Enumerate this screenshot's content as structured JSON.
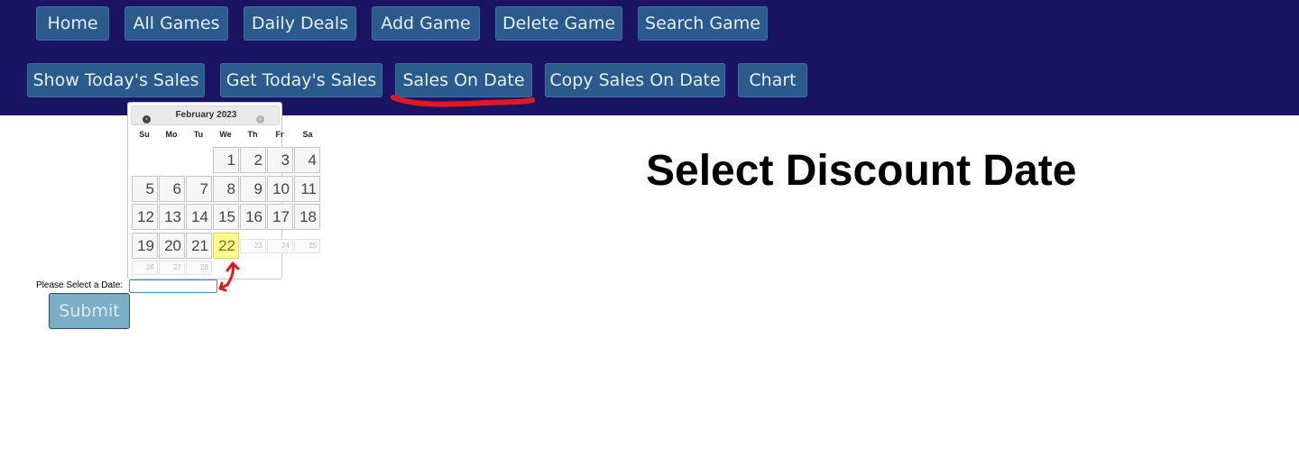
{
  "nav": {
    "row1": [
      "Home",
      "All Games",
      "Daily Deals",
      "Add Game",
      "Delete Game",
      "Search Game"
    ],
    "row2": [
      "Show Today's Sales",
      "Get Today's Sales",
      "Sales On Date",
      "Copy Sales On Date",
      "Chart"
    ],
    "active": "Sales On Date"
  },
  "page": {
    "title": "Select Discount Date",
    "date_label": "Please Select a Date:",
    "date_value": "",
    "submit_label": "Submit"
  },
  "calendar": {
    "month": "February 2023",
    "prev_icon": "‹",
    "next_icon": "›",
    "weekdays": [
      "Su",
      "Mo",
      "Tu",
      "We",
      "Th",
      "Fr",
      "Sa"
    ],
    "days": [
      "1",
      "2",
      "3",
      "4",
      "5",
      "6",
      "7",
      "8",
      "9",
      "10",
      "11",
      "12",
      "13",
      "14",
      "15",
      "16",
      "17",
      "18",
      "19",
      "20",
      "21",
      "22",
      "23",
      "24",
      "25",
      "26",
      "27",
      "28"
    ],
    "today": "22",
    "disabled": [
      "23",
      "24",
      "25",
      "26",
      "27",
      "28"
    ]
  },
  "colors": {
    "header_bg": "#1a1462",
    "button_bg": "#2a5b8c",
    "annotation": "#e0191f",
    "today_highlight": "#fffa90"
  }
}
